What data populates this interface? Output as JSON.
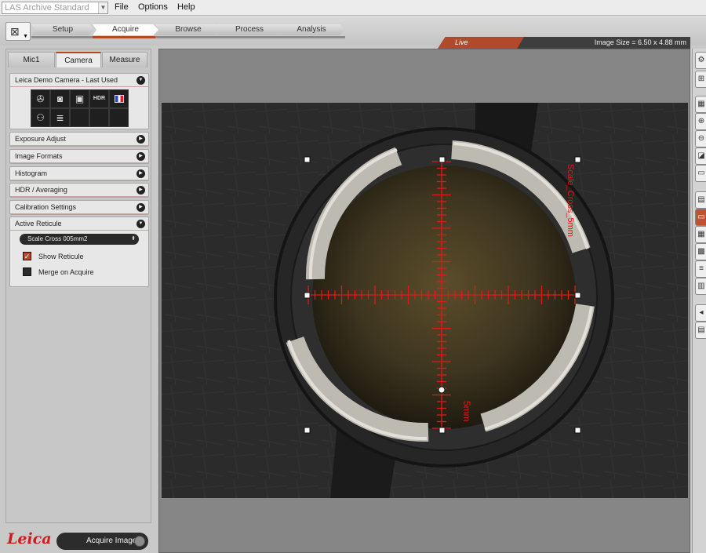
{
  "app_title": "LAS Archive Standard",
  "menu": [
    "File",
    "Options",
    "Help"
  ],
  "workflow_tabs": [
    "Setup",
    "Acquire",
    "Browse",
    "Process",
    "Analysis"
  ],
  "active_workflow_tab": "Acquire",
  "status": {
    "mode": "Live",
    "image_size": "Image Size = 6.50 x 4.88 mm"
  },
  "panel_tabs": [
    "Mic1",
    "Camera",
    "Measure"
  ],
  "active_panel_tab": "Camera",
  "camera_section": {
    "title": "Leica Demo Camera - Last Used",
    "icons": [
      "aperture-icon",
      "camera-icon",
      "camera-settings-icon",
      "hdr-icon",
      "color-bars-icon",
      "molecule-icon",
      "list-settings-icon"
    ],
    "hdr_label": "HDR"
  },
  "collapsed_sections": [
    "Exposure Adjust",
    "Image Formats",
    "Histogram",
    "HDR / Averaging",
    "Calibration Settings"
  ],
  "reticule_section": {
    "title": "Active Reticule",
    "selected": "Scale Cross 005mm2",
    "show_reticule_label": "Show Reticule",
    "show_reticule": true,
    "merge_label": "Merge on Acquire",
    "merge": false
  },
  "logo_text": "Leica",
  "acquire_button": "Acquire Image",
  "reticule_labels": {
    "vertical_caption": "Scale_Cross_5mm",
    "scale": "5mm"
  },
  "colors": {
    "accent": "#b24a2a",
    "reticule": "#e01818",
    "live": "#b14a2b"
  }
}
